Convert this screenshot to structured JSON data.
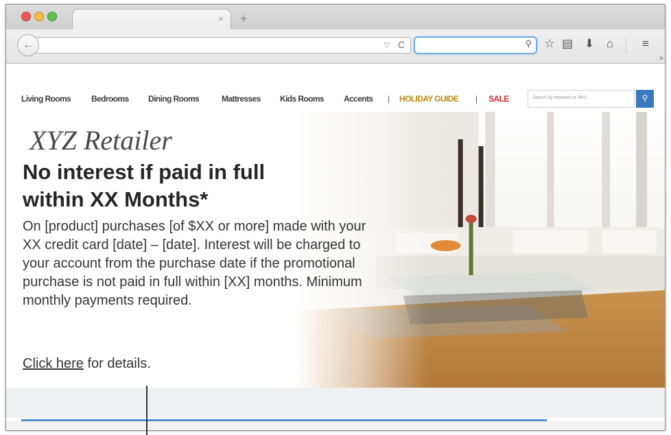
{
  "browser": {
    "tab_close": "×",
    "new_tab": "+",
    "back_glyph": "←",
    "url_value": "",
    "url_dropdown": "▽",
    "reload_glyph": "C",
    "search_value": "",
    "search_glyph": "⚲",
    "overflow_glyph": "»"
  },
  "site_nav": {
    "items": [
      "Living Rooms",
      "Bedrooms",
      "Dining Rooms",
      "Mattresses",
      "Kids Rooms",
      "Accents"
    ],
    "separator": "|",
    "holiday": "HOLIDAY GUIDE",
    "sale": "SALE",
    "search_placeholder": "Search by keyword or SKU"
  },
  "hero": {
    "brand": "XYZ Retailer",
    "headline": "No interest if paid in full within XX Months*",
    "body": "On [product] purchases [of $XX or more] made with your XX credit card [date] – [date]. Interest will be charged to your account from the purchase date if the promotional purchase is not paid in full within [XX] months. Minimum monthly payments required.",
    "details_link": "Click here",
    "details_rest": " for details."
  },
  "colors": {
    "holiday": "#c28a16",
    "sale": "#d12a2a",
    "search_button": "#3a78bf",
    "search_focus": "#6faee9"
  }
}
